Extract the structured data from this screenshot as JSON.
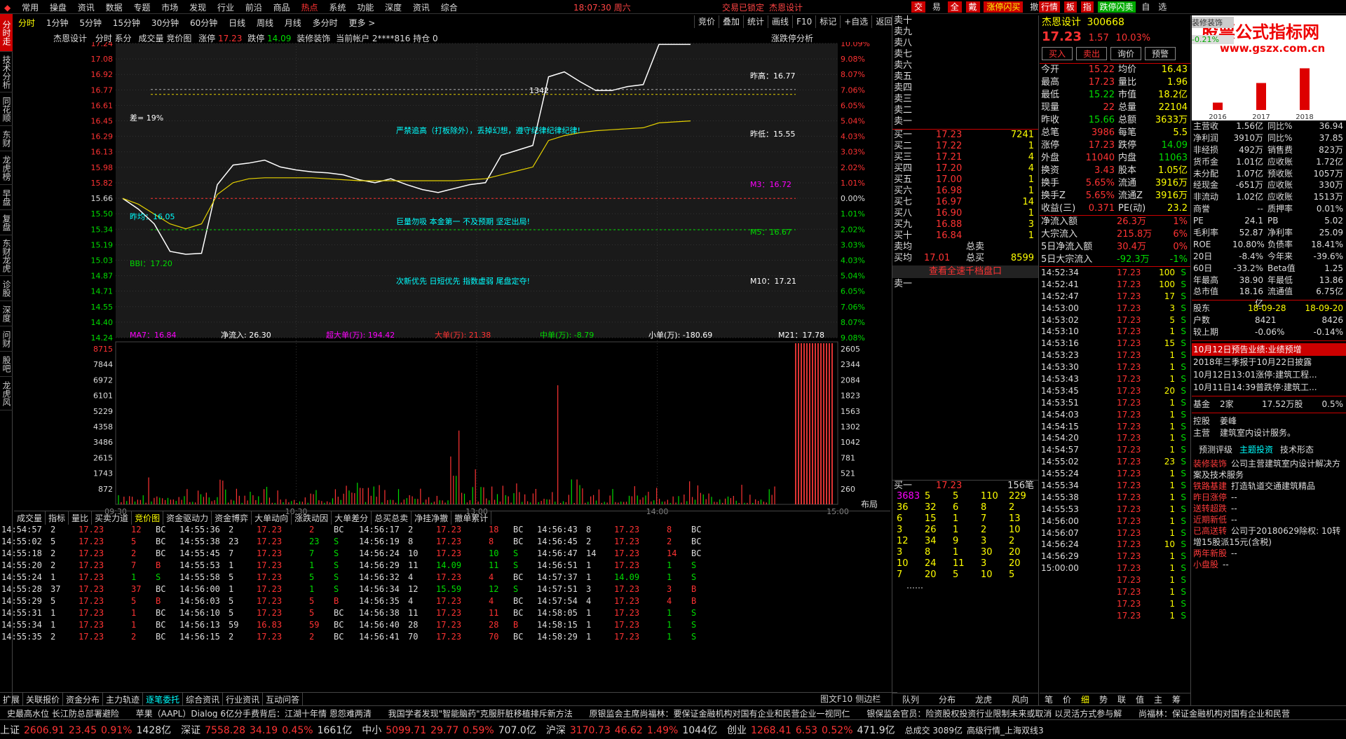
{
  "menu": {
    "items": [
      "常用",
      "操盘",
      "资讯",
      "数据",
      "专题",
      "市场",
      "发现",
      "行业",
      "前沿",
      "商品",
      "热点",
      "系统",
      "功能",
      "深度",
      "资讯",
      "综合"
    ],
    "time": "18:07:30 周六",
    "lock": "交易已锁定",
    "stock_title": "杰恩设计",
    "right_tabs": [
      "交",
      "易",
      "全",
      "戴",
      "涨停闪买",
      "撤",
      "查"
    ],
    "far_right_tabs": [
      "行情",
      "板",
      "指",
      "跌停闪卖",
      "自",
      "选"
    ]
  },
  "period_tabs": [
    "分时",
    "1分钟",
    "5分钟",
    "15分钟",
    "30分钟",
    "60分钟",
    "日线",
    "周线",
    "月线",
    "多分时",
    "更多 >"
  ],
  "chart_tools": [
    "竞价",
    "叠加",
    "统计",
    "画线",
    "F10",
    "标记",
    "+自选",
    "返回"
  ],
  "left_sidebar": [
    "分时走势",
    "技术分析",
    "同花顺",
    "东财",
    "龙虎榜",
    "早盘",
    "复盘",
    "东财龙虎",
    "诊股",
    "深度",
    "问财",
    "股吧",
    "龙虎风"
  ],
  "chart_header": {
    "name": "杰恩设计",
    "mode": "分时 系分",
    "items": "成交量 竞价图",
    "limit_up_label": "涨停",
    "limit_up": "17.23",
    "limit_down_label": "跌停",
    "limit_down": "14.09",
    "tag": "装修装饰",
    "account": "当前帐户 2****816 持仓 0",
    "right": "涨跌停分析"
  },
  "chart_data": {
    "type": "line",
    "title": "",
    "xlabel": "",
    "ylabel": "",
    "ylim": [
      14.24,
      17.24
    ],
    "x_tick_labels": [
      "09:30",
      "10:30",
      "13:00",
      "14:00",
      "15:00"
    ],
    "price_ticks": [
      "17.24",
      "17.08",
      "16.92",
      "16.77",
      "16.61",
      "16.45",
      "16.29",
      "16.13",
      "15.98",
      "15.82",
      "15.66",
      "15.50",
      "15.34",
      "15.19",
      "15.03",
      "14.87",
      "14.71",
      "14.55",
      "14.40",
      "14.24"
    ],
    "pct_ticks": [
      "10.09%",
      "9.08%",
      "8.07%",
      "7.06%",
      "6.05%",
      "5.04%",
      "4.03%",
      "3.03%",
      "2.02%",
      "1.01%",
      "0.00%",
      "1.01%",
      "2.02%",
      "3.03%",
      "4.03%",
      "5.04%",
      "6.05%",
      "7.06%",
      "8.07%",
      "9.08%"
    ],
    "vol_ticks": [
      "8715",
      "7844",
      "6972",
      "6101",
      "5229",
      "4358",
      "3486",
      "2615",
      "1743",
      "872"
    ],
    "vol_right_ticks": [
      "2605",
      "2344",
      "2084",
      "1823",
      "1563",
      "1302",
      "1042",
      "781",
      "521",
      "260"
    ],
    "series": [
      {
        "values": [
          15.66,
          15.55,
          15.4,
          15.12,
          15.09,
          15.1,
          15.8,
          16.0,
          16.02,
          16.05,
          15.98,
          15.95,
          15.93,
          15.92,
          15.9,
          15.85,
          15.82,
          15.86,
          15.8,
          15.75,
          15.72,
          15.76,
          15.8,
          15.82,
          16.1,
          16.15,
          16.2,
          16.9,
          16.95,
          16.85,
          16.76,
          16.76,
          16.8,
          16.82,
          17.23,
          17.23,
          17.23
        ]
      },
      {
        "values": [
          15.66,
          15.6,
          15.5,
          15.4,
          15.35,
          15.4,
          15.7,
          15.82,
          15.86,
          15.87,
          15.87,
          15.87,
          15.87,
          15.86,
          15.85,
          15.84,
          15.84,
          15.84,
          15.84,
          15.84,
          15.84,
          15.84,
          15.85,
          15.86,
          15.9,
          15.94,
          15.98,
          16.25,
          16.3,
          16.33,
          16.35,
          16.36,
          16.37,
          16.38,
          16.43,
          16.44,
          16.45
        ]
      }
    ],
    "annotations": [
      "差= 19%",
      "严禁追高（打板除外），丢掉幻想，遵守纪律纪律纪律!",
      "巨量勿吸 本金第一 不及预期 坚定出局!",
      "次新优先 日短优先 指数虚弱 尾盘定夺!",
      "昨高：16.77",
      "昨低：15.55",
      "M3：16.72",
      "M5：16.67",
      "M10：17.21",
      "昨均：16.05",
      "BBI：17.20",
      "1342"
    ],
    "flow_labels": {
      "ma7": "MA7：16.84",
      "in": "净流入: 26.30",
      "super": "超大单(万): 194.42",
      "big": "大单(万): 21.38",
      "mid": "中单(万): -8.79",
      "small": "小单(万): -180.69",
      "m21": "M21：17.78"
    }
  },
  "lower_tabs": [
    "成交量",
    "指标",
    "量比",
    "买卖力道",
    "竞价图",
    "资金驱动力",
    "资金博弈",
    "大单动向",
    "涨跌动因",
    "大单差分",
    "总买总卖",
    "净挂净撤",
    "撤单累计"
  ],
  "layout_btn": "布局",
  "trades": [
    [
      "14:54:57",
      "2",
      "17.23",
      "12",
      "BC"
    ],
    [
      "14:55:02",
      "5",
      "17.23",
      "5",
      "BC"
    ],
    [
      "14:55:18",
      "2",
      "17.23",
      "2",
      "BC"
    ],
    [
      "14:55:20",
      "2",
      "17.23",
      "7",
      "B"
    ],
    [
      "14:55:24",
      "1",
      "17.23",
      "1",
      "S"
    ],
    [
      "14:55:28",
      "37",
      "17.23",
      "37",
      "BC"
    ],
    [
      "14:55:29",
      "5",
      "17.23",
      "5",
      "B"
    ],
    [
      "14:55:31",
      "1",
      "17.23",
      "1",
      "BC"
    ],
    [
      "14:55:34",
      "1",
      "17.23",
      "1",
      "BC"
    ],
    [
      "14:55:35",
      "2",
      "17.23",
      "2",
      "BC"
    ]
  ],
  "trades_b": [
    [
      "14:55:36",
      "2",
      "17.23",
      "2",
      "BC"
    ],
    [
      "14:55:38",
      "23",
      "17.23",
      "23",
      "S"
    ],
    [
      "14:55:45",
      "7",
      "17.23",
      "7",
      "S"
    ],
    [
      "14:55:53",
      "1",
      "17.23",
      "1",
      "S"
    ],
    [
      "14:55:58",
      "5",
      "17.23",
      "5",
      "S"
    ],
    [
      "14:56:00",
      "1",
      "17.23",
      "1",
      "S"
    ],
    [
      "14:56:03",
      "5",
      "17.23",
      "5",
      "B"
    ],
    [
      "14:56:10",
      "5",
      "17.23",
      "5",
      "BC"
    ],
    [
      "14:56:13",
      "59",
      "16.83",
      "59",
      "BC"
    ],
    [
      "14:56:15",
      "2",
      "17.23",
      "2",
      "BC"
    ]
  ],
  "trades_c": [
    [
      "14:56:17",
      "2",
      "17.23",
      "18",
      "BC"
    ],
    [
      "14:56:19",
      "8",
      "17.23",
      "8",
      "BC"
    ],
    [
      "14:56:24",
      "10",
      "17.23",
      "10",
      "S"
    ],
    [
      "14:56:29",
      "11",
      "14.09",
      "11",
      "S"
    ],
    [
      "14:56:32",
      "4",
      "17.23",
      "4",
      "BC"
    ],
    [
      "14:56:34",
      "12",
      "15.59",
      "12",
      "S"
    ],
    [
      "14:56:35",
      "4",
      "17.23",
      "4",
      "BC"
    ],
    [
      "14:56:38",
      "11",
      "17.23",
      "11",
      "BC"
    ],
    [
      "14:56:40",
      "28",
      "17.23",
      "28",
      "B"
    ],
    [
      "14:56:41",
      "70",
      "17.23",
      "70",
      "BC"
    ]
  ],
  "trades_d": [
    [
      "14:56:43",
      "8",
      "17.23",
      "8",
      "BC"
    ],
    [
      "14:56:45",
      "2",
      "17.23",
      "2",
      "BC"
    ],
    [
      "14:56:47",
      "14",
      "17.23",
      "14",
      "BC"
    ],
    [
      "14:56:51",
      "1",
      "17.23",
      "1",
      "S"
    ],
    [
      "14:57:37",
      "1",
      "14.09",
      "1",
      "S"
    ],
    [
      "14:57:51",
      "3",
      "17.23",
      "3",
      "B"
    ],
    [
      "14:57:54",
      "4",
      "17.23",
      "4",
      "B"
    ],
    [
      "14:58:05",
      "1",
      "17.23",
      "1",
      "S"
    ],
    [
      "14:58:15",
      "1",
      "17.23",
      "1",
      "S"
    ],
    [
      "14:58:29",
      "1",
      "17.23",
      "1",
      "S"
    ]
  ],
  "bottom_tabs": [
    "扩展",
    "关联报价",
    "资金分布",
    "主力轨迹",
    "逐笔委托",
    "综合资讯",
    "行业资讯",
    "互动问答"
  ],
  "bottom_right_tabs": [
    "图文F10",
    "侧边栏"
  ],
  "order_book": {
    "asks": [
      "卖十",
      "卖九",
      "卖八",
      "卖七",
      "卖六",
      "卖五",
      "卖四",
      "卖三",
      "卖二",
      "卖一"
    ],
    "bids": [
      [
        "买一",
        "17.23",
        "7241"
      ],
      [
        "买二",
        "17.22",
        "1"
      ],
      [
        "买三",
        "17.21",
        "4"
      ],
      [
        "买四",
        "17.20",
        "4"
      ],
      [
        "买五",
        "17.00",
        "1"
      ],
      [
        "买六",
        "16.98",
        "1"
      ],
      [
        "买七",
        "16.97",
        "14"
      ],
      [
        "买八",
        "16.90",
        "1"
      ],
      [
        "买九",
        "16.88",
        "3"
      ],
      [
        "买十",
        "16.84",
        "1"
      ]
    ],
    "avg_sell_label": "卖均",
    "total_sell_label": "总卖",
    "avg_buy_label": "买均",
    "avg_buy": "17.01",
    "total_buy_label": "总买",
    "total_buy": "8599",
    "link": "查看全速千档盘口",
    "sell1": "卖一",
    "buy1": "买一",
    "buy1_price": "17.23",
    "buy1_vol": "156笔",
    "queue": [
      [
        "3683",
        "5",
        "5",
        "110",
        "229"
      ],
      [
        "36",
        "32",
        "6",
        "8",
        "2"
      ],
      [
        "6",
        "15",
        "1",
        "7",
        "13"
      ],
      [
        "3",
        "26",
        "1",
        "2",
        "10"
      ],
      [
        "12",
        "34",
        "9",
        "3",
        "2"
      ],
      [
        "3",
        "8",
        "1",
        "30",
        "20"
      ],
      [
        "10",
        "24",
        "11",
        "3",
        "20"
      ],
      [
        "7",
        "20",
        "5",
        "10",
        "5"
      ]
    ],
    "queue_more": "……",
    "bottom": [
      "队列",
      "分布",
      "龙虎",
      "风向"
    ]
  },
  "quote": {
    "name": "杰恩设计",
    "code": "300668",
    "price": "17.23",
    "change": "1.57",
    "pct": "10.03%",
    "buttons": [
      "买入",
      "卖出",
      "询价",
      "预警"
    ],
    "rows": [
      [
        "今开",
        "15.22",
        "均价",
        "16.43"
      ],
      [
        "最高",
        "17.23",
        "量比",
        "1.96"
      ],
      [
        "最低",
        "15.22",
        "市值",
        "18.2亿"
      ],
      [
        "现量",
        "22",
        "总量",
        "22104"
      ],
      [
        "昨收",
        "15.66",
        "总额",
        "3633万"
      ],
      [
        "总笔",
        "3986",
        "每笔",
        "5.5"
      ],
      [
        "涨停",
        "17.23",
        "跌停",
        "14.09"
      ],
      [
        "外盘",
        "11040",
        "内盘",
        "11063"
      ],
      [
        "换资",
        "3.43",
        "股本",
        "1.05亿"
      ],
      [
        "换手",
        "5.65%",
        "流通",
        "3916万"
      ],
      [
        "换手Z",
        "5.65%",
        "流通Z",
        "3916万"
      ],
      [
        "收益(三)",
        "0.371",
        "PE(动)",
        "23.2"
      ]
    ],
    "flows": [
      [
        "净流入额",
        "26.3万",
        "1%"
      ],
      [
        "大宗流入",
        "215.8万",
        "6%"
      ],
      [
        "5日净流入额",
        "30.4万",
        "0%"
      ],
      [
        "5日大宗流入",
        "-92.3万",
        "-1%"
      ]
    ],
    "ticks": [
      [
        "14:52:34",
        "17.23",
        "100",
        "S"
      ],
      [
        "14:52:41",
        "17.23",
        "100",
        "S"
      ],
      [
        "14:52:47",
        "17.23",
        "17",
        "S"
      ],
      [
        "14:53:00",
        "17.23",
        "3",
        "S"
      ],
      [
        "14:53:02",
        "17.23",
        "5",
        "S"
      ],
      [
        "14:53:10",
        "17.23",
        "1",
        "S"
      ],
      [
        "14:53:16",
        "17.23",
        "15",
        "S"
      ],
      [
        "14:53:23",
        "17.23",
        "1",
        "S"
      ],
      [
        "14:53:30",
        "17.23",
        "1",
        "S"
      ],
      [
        "14:53:43",
        "17.23",
        "1",
        "S"
      ],
      [
        "14:53:45",
        "17.23",
        "20",
        "S"
      ],
      [
        "14:53:51",
        "17.23",
        "1",
        "S"
      ],
      [
        "14:54:03",
        "17.23",
        "1",
        "S"
      ],
      [
        "14:54:15",
        "17.23",
        "1",
        "S"
      ],
      [
        "14:54:20",
        "17.23",
        "1",
        "S"
      ],
      [
        "14:54:57",
        "17.23",
        "1",
        "S"
      ],
      [
        "14:55:02",
        "17.23",
        "23",
        "S"
      ],
      [
        "14:55:24",
        "17.23",
        "1",
        "S"
      ],
      [
        "14:55:34",
        "17.23",
        "1",
        "S"
      ],
      [
        "14:55:38",
        "17.23",
        "1",
        "S"
      ],
      [
        "14:55:53",
        "17.23",
        "1",
        "S"
      ],
      [
        "14:56:00",
        "17.23",
        "1",
        "S"
      ],
      [
        "14:56:07",
        "17.23",
        "1",
        "S"
      ],
      [
        "14:56:24",
        "17.23",
        "10",
        "S"
      ],
      [
        "14:56:29",
        "17.23",
        "1",
        "S"
      ],
      [
        "15:00:00",
        "17.23",
        "1",
        "S"
      ],
      [
        "",
        "17.23",
        "1",
        "S"
      ],
      [
        "",
        "17.23",
        "1",
        "S"
      ],
      [
        "",
        "17.23",
        "1",
        "S"
      ],
      [
        "",
        "17.23",
        "1",
        "S"
      ]
    ],
    "bottom": [
      "笔",
      "价",
      "细",
      "势",
      "联",
      "值",
      "主",
      "筹"
    ]
  },
  "f10": {
    "watermark": "股票公式指标网",
    "watermark_url": "www.gszx.com.cn",
    "mini_tabs": [
      "装修装饰",
      "-0.21%"
    ],
    "years": [
      "2016",
      "2017",
      "2018"
    ],
    "bars": [
      0.15,
      0.55,
      0.85
    ],
    "rows": [
      [
        "主营收",
        "1.56亿",
        "同比%",
        "36.94"
      ],
      [
        "净利润",
        "3910万",
        "同比%",
        "37.85"
      ],
      [
        "非经损",
        "492万",
        "销售费",
        "823万"
      ],
      [
        "货币金",
        "1.01亿",
        "应收账",
        "1.72亿"
      ],
      [
        "未分配",
        "1.07亿",
        "预收账",
        "1057万"
      ],
      [
        "经现金",
        "-651万",
        "应收账",
        "330万"
      ],
      [
        "非流动",
        "1.02亿",
        "应收账",
        "1513万"
      ],
      [
        "商誉",
        "--",
        "质押率",
        "0.01%"
      ],
      [
        "PE",
        "24.1",
        "PB",
        "5.02"
      ],
      [
        "毛利率",
        "52.87",
        "净利率",
        "25.09"
      ],
      [
        "ROE",
        "10.80%",
        "负债率",
        "18.41%"
      ],
      [
        "20日",
        "-8.4%",
        "今年来",
        "-39.6%"
      ],
      [
        "60日",
        "-33.2%",
        "Beta值",
        "1.25"
      ],
      [
        "年最高",
        "38.90",
        "年最低",
        "13.86"
      ],
      [
        "总市值",
        "18.16亿",
        "流通值",
        "6.75亿"
      ]
    ],
    "holders_label": "股东",
    "holders_date1": "18-09-28",
    "holders_date2": "18-09-20",
    "households_label": "户数",
    "households1": "8421",
    "households2": "8426",
    "compare_label": "较上期",
    "compare1": "-0.06%",
    "compare2": "-0.14%",
    "news": [
      "10月12日预告业绩:业绩预增",
      "2018年三季报于10月22日披露",
      "10月12日13:01涨停:建筑工程...",
      "10月11日14:39普跌停:建筑工..."
    ],
    "fund_label": "基金",
    "fund_count": "2家",
    "fund_amount": "17.52万股",
    "fund_pct": "0.5%",
    "control_label": "控股",
    "control": "姜峰",
    "main_label": "主营",
    "main": "建筑室内设计服务。",
    "tabs": [
      "预测评级",
      "主题投资",
      "技术形态"
    ],
    "themes": [
      [
        "装修装饰",
        "公司主营建筑室内设计解决方案及技术服务"
      ],
      [
        "铁路基建",
        "打造轨道交通建筑精品"
      ],
      [
        "昨日涨停",
        "--"
      ],
      [
        "送转超跌",
        "--"
      ],
      [
        "近期新低",
        "--"
      ],
      [
        "已高送转",
        "公司于20180629除权: 10转增15股派15元(含税)"
      ],
      [
        "两年新股",
        "--"
      ],
      [
        "小盘股",
        "--"
      ]
    ]
  },
  "ticker": [
    "史最高水位 长江防总部署避险",
    "苹果（AAPL）Dialog 6亿分手费背后：江湖十年情 恩怨难两清",
    "我国学者发现\"智能脑药\"克服肝脏移植排斥新方法",
    "原银监会主席尚福林：要保证金融机构对国有企业和民营企业一视同仁",
    "银保监会官员：险资股权投资行业限制未来或取消 以灵活方式参与解",
    "尚福林：保证金融机构对国有企业和民营"
  ],
  "status": [
    {
      "name": "上证",
      "val": "2606.91",
      "chg": "23.45",
      "pct": "0.91%",
      "amt": "1428亿"
    },
    {
      "name": "深证",
      "val": "7558.28",
      "chg": "34.19",
      "pct": "0.45%",
      "amt": "1661亿"
    },
    {
      "name": "中小",
      "val": "5099.71",
      "chg": "29.77",
      "pct": "0.59%",
      "amt": "707.0亿"
    },
    {
      "name": "沪深",
      "val": "3170.73",
      "chg": "46.62",
      "pct": "1.49%",
      "amt": "1044亿"
    },
    {
      "name": "创业",
      "val": "1268.41",
      "chg": "6.53",
      "pct": "0.52%",
      "amt": "471.9亿"
    }
  ],
  "status_extra": [
    "总成交 3089亿",
    "高级行情_上海双线3"
  ]
}
